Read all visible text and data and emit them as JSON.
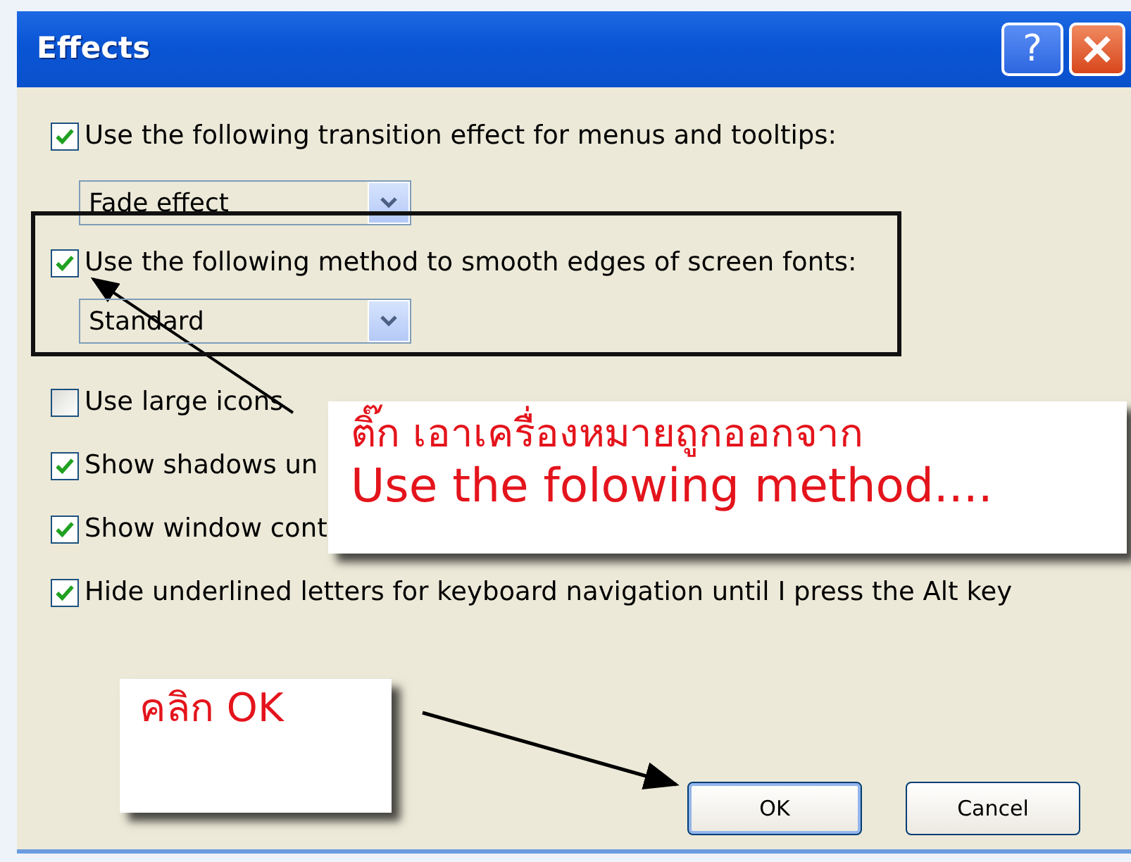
{
  "window": {
    "title": "Effects",
    "help_button": "?"
  },
  "options": [
    {
      "label": "Use the following transition effect for menus and tooltips:",
      "checked": true,
      "dropdown": {
        "value": "Fade effect"
      }
    },
    {
      "label": "Use the following method to smooth edges of screen fonts:",
      "checked": true,
      "dropdown": {
        "value": "Standard"
      }
    },
    {
      "label": "Use large icons",
      "checked": false
    },
    {
      "label": "Show shadows un",
      "checked": true
    },
    {
      "label": "Show window cont",
      "checked": true
    },
    {
      "label": "Hide underlined letters for keyboard navigation until I press the Alt key",
      "checked": true
    }
  ],
  "buttons": [
    {
      "label": "OK",
      "default": true
    },
    {
      "label": "Cancel",
      "default": false
    }
  ],
  "annotations": [
    {
      "kind": "callout",
      "lines": [
        "ติ๊ก เอาเครื่องหมายถูกออกจาก",
        "Use the folowing method...."
      ]
    },
    {
      "kind": "callout",
      "lines": [
        "คลิก OK"
      ]
    }
  ]
}
